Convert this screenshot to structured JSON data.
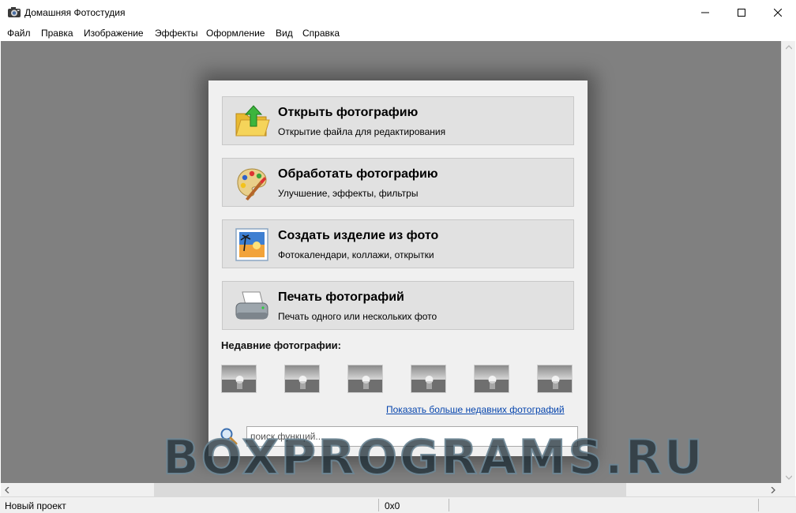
{
  "window": {
    "title": "Домашняя Фотостудия",
    "icon": "camera-icon"
  },
  "menu": [
    "Файл",
    "Правка",
    "Изображение",
    "Эффекты",
    "Оформление",
    "Вид",
    "Справка"
  ],
  "actions": [
    {
      "title": "Открыть фотографию",
      "subtitle": "Открытие файла для редактирования",
      "icon": "open-folder-icon"
    },
    {
      "title": "Обработать фотографию",
      "subtitle": "Улучшение, эффекты, фильтры",
      "icon": "palette-icon"
    },
    {
      "title": "Создать изделие из фото",
      "subtitle": "Фотокалендари, коллажи, открытки",
      "icon": "photo-product-icon"
    },
    {
      "title": "Печать фотографий",
      "subtitle": "Печать одного или нескольких фото",
      "icon": "printer-icon"
    }
  ],
  "recent": {
    "title": "Недавние фотографии:",
    "count": 6,
    "more_link": "Показать больше недавних фотографий"
  },
  "search": {
    "placeholder": "поиск функций...",
    "value": ""
  },
  "status": {
    "left": "Новый проект",
    "middle": "0x0"
  },
  "watermark": "BOXPROGRAMS.RU",
  "colors": {
    "workspace": "#808080",
    "panel": "#f0f0f0",
    "button": "#e1e1e1",
    "link": "#0645ad"
  }
}
